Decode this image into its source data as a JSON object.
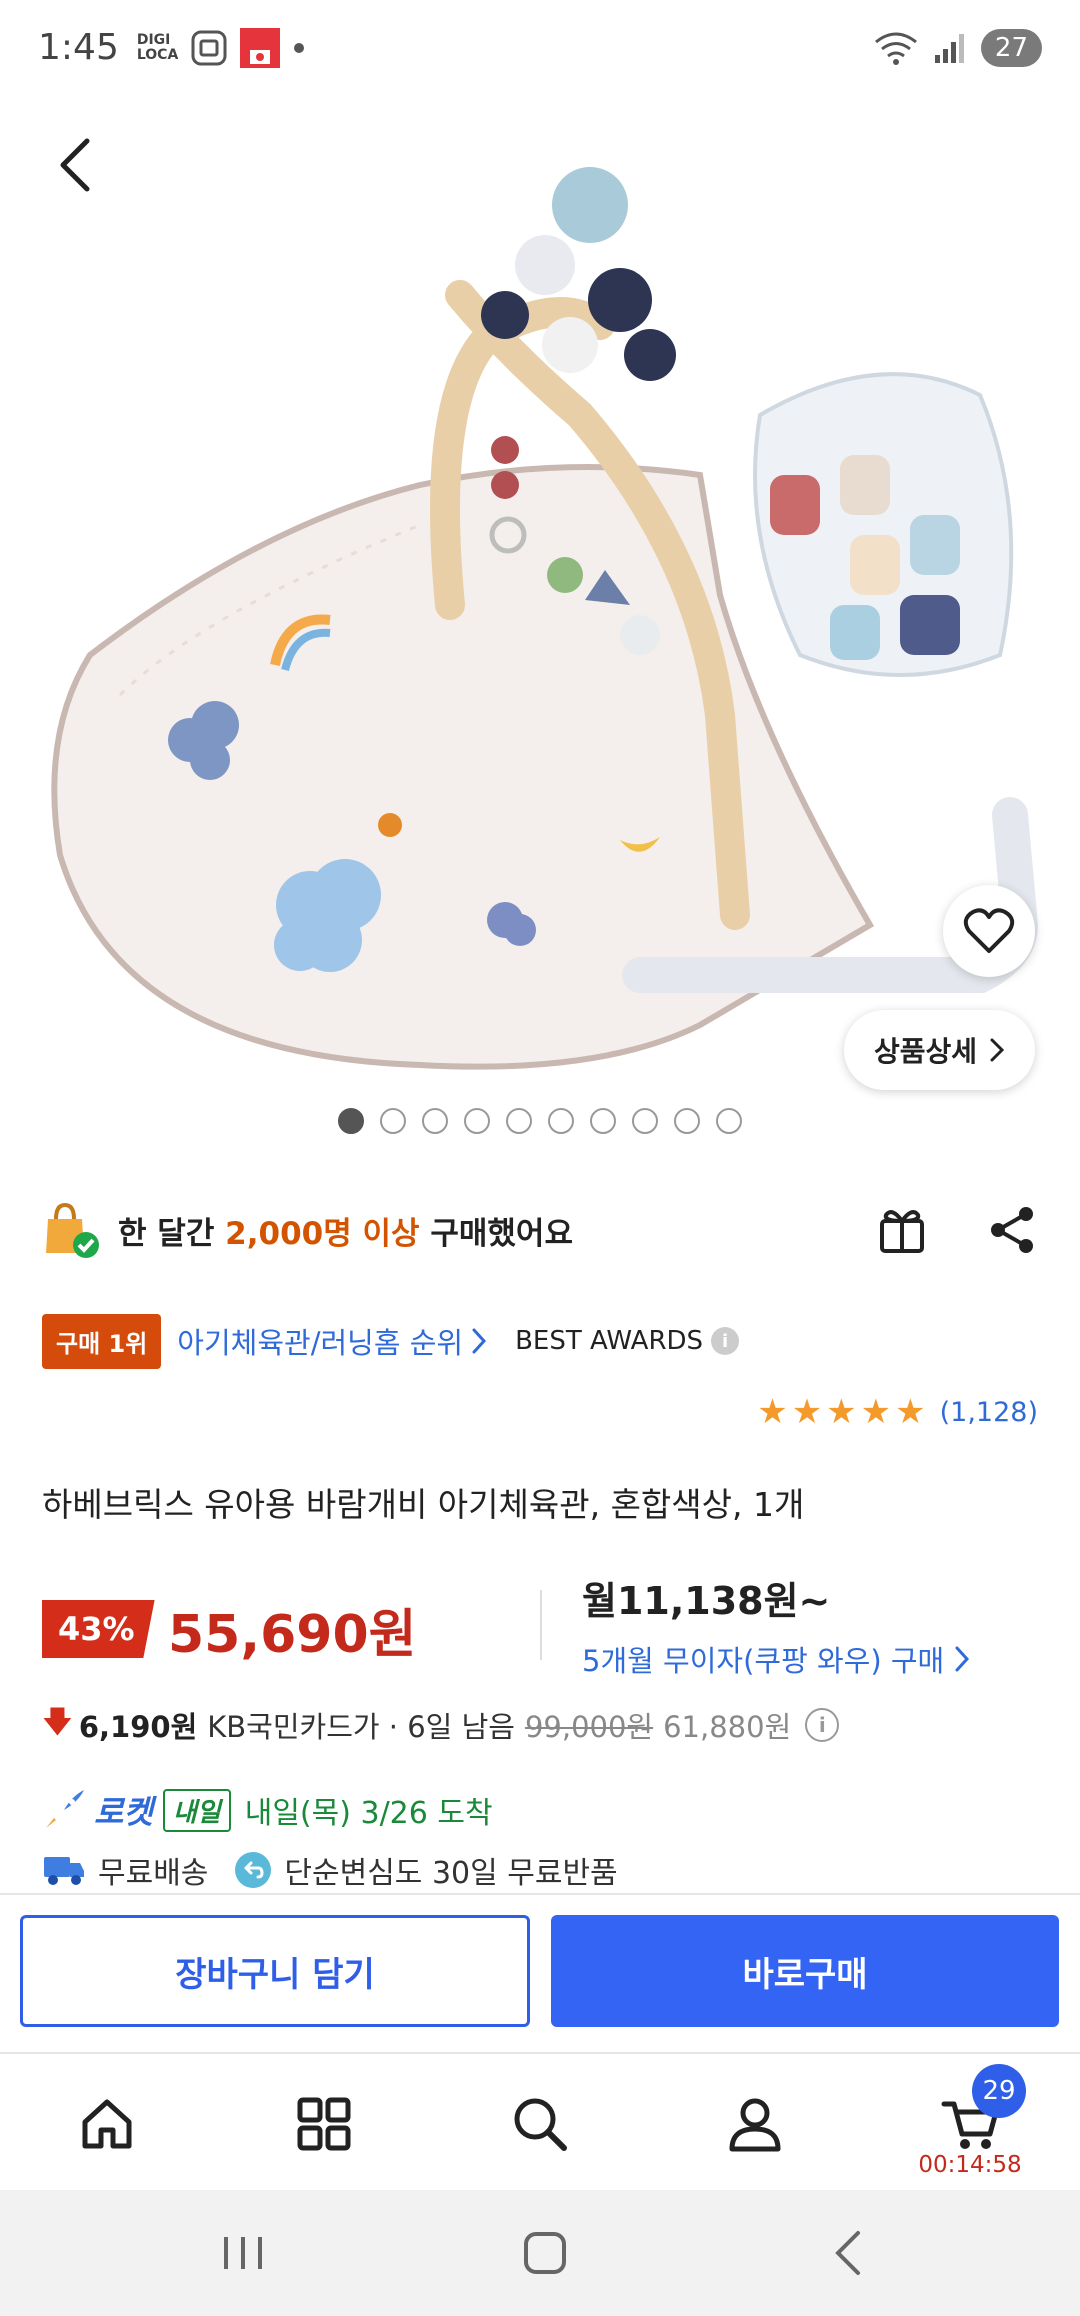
{
  "status_bar": {
    "time": "1:45",
    "digi_top": "DIGI",
    "digi_bottom": "LOCA",
    "battery": "27"
  },
  "hero": {
    "detail_label": "상품상세",
    "image_count": 10,
    "active_index": 0
  },
  "buyers": {
    "prefix": "한 달간 ",
    "highlight": "2,000명 이상",
    "suffix": " 구매했어요"
  },
  "rank": {
    "badge": "구매 1위",
    "link": "아기체육관/러닝홈 순위",
    "awards": "BEST AWARDS"
  },
  "rating": {
    "stars": 5,
    "count": "(1,128)"
  },
  "product": {
    "title": "하베브릭스 유아용 바람개비 아기체육관, 혼합색상, 1개"
  },
  "price": {
    "discount": "43%",
    "sale": "55,690원",
    "monthly": "월11,138원~",
    "installment": "5개월 무이자(쿠팡 와우) 구매"
  },
  "card_offer": {
    "amount": "6,190원",
    "text": "KB국민카드가 · 6일 남음",
    "original": "99,000원",
    "final": "61,880원"
  },
  "delivery": {
    "rocket": "로켓",
    "tag": "내일",
    "arrival": "내일(목) 3/26 도착",
    "free_shipping": "무료배송",
    "return": "단순변심도 30일 무료반품"
  },
  "actions": {
    "cart": "장바구니 담기",
    "buy": "바로구매"
  },
  "bottom_nav": {
    "cart_count": "29",
    "timer": "00:14:58"
  },
  "colors": {
    "accent_blue": "#3464f3",
    "price_red": "#c42a1b",
    "rank_orange": "#d44b0c",
    "delivery_green": "#1a8a3a"
  }
}
